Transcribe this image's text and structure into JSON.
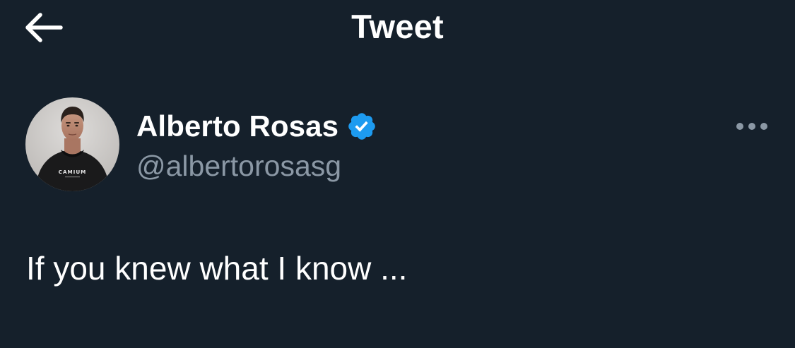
{
  "header": {
    "title": "Tweet",
    "back_icon": "arrow-left-icon"
  },
  "author": {
    "display_name": "Alberto Rosas",
    "handle": "@albertorosasg",
    "verified": true,
    "verified_icon": "verified-badge-icon",
    "avatar_icon": "avatar-photo",
    "avatar_shirt_text": "CAMIUM"
  },
  "menu": {
    "icon": "more-horizontal-icon"
  },
  "tweet": {
    "text": "If you knew what I know ..."
  },
  "colors": {
    "background": "#15202b",
    "text_primary": "#ffffff",
    "text_secondary": "#8b98a5",
    "verified_blue": "#1d9bf0"
  }
}
